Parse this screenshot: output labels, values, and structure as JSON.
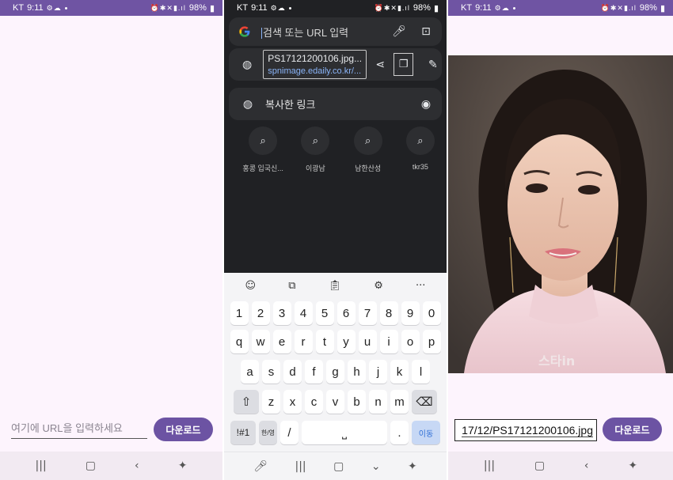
{
  "status": {
    "carrier": "KT",
    "time": "9:11",
    "battery": "98%"
  },
  "screen1": {
    "placeholder": "여기에 URL을 입력하세요",
    "download_label": "다운로드"
  },
  "screen2": {
    "search_placeholder": "검색 또는 URL 입력",
    "clipboard_title": "PS17121200106.jpg...",
    "clipboard_url": "spnimage.edaily.co.kr/...",
    "copied_link_label": "복사한 링크",
    "suggestions": [
      "홍콩 입국신...",
      "이광남",
      "남한산성",
      "tkr35"
    ],
    "keyboard": {
      "numbers": [
        "1",
        "2",
        "3",
        "4",
        "5",
        "6",
        "7",
        "8",
        "9",
        "0"
      ],
      "row1": [
        "q",
        "w",
        "e",
        "r",
        "t",
        "y",
        "u",
        "i",
        "o",
        "p"
      ],
      "row2": [
        "a",
        "s",
        "d",
        "f",
        "g",
        "h",
        "j",
        "k",
        "l"
      ],
      "row3": [
        "z",
        "x",
        "c",
        "v",
        "b",
        "n",
        "m"
      ],
      "sym_key": "!#1",
      "lang_key": "한/영",
      "slash_key": "/",
      "period_key": ".",
      "go_key": "이동"
    }
  },
  "screen3": {
    "url_value": "17/12/PS17121200106.jpg",
    "download_label": "다운로드",
    "watermark": "스타in"
  },
  "colors": {
    "accent": "#6c53a3",
    "dark_bg": "#202124",
    "link": "#8ab4f8"
  }
}
